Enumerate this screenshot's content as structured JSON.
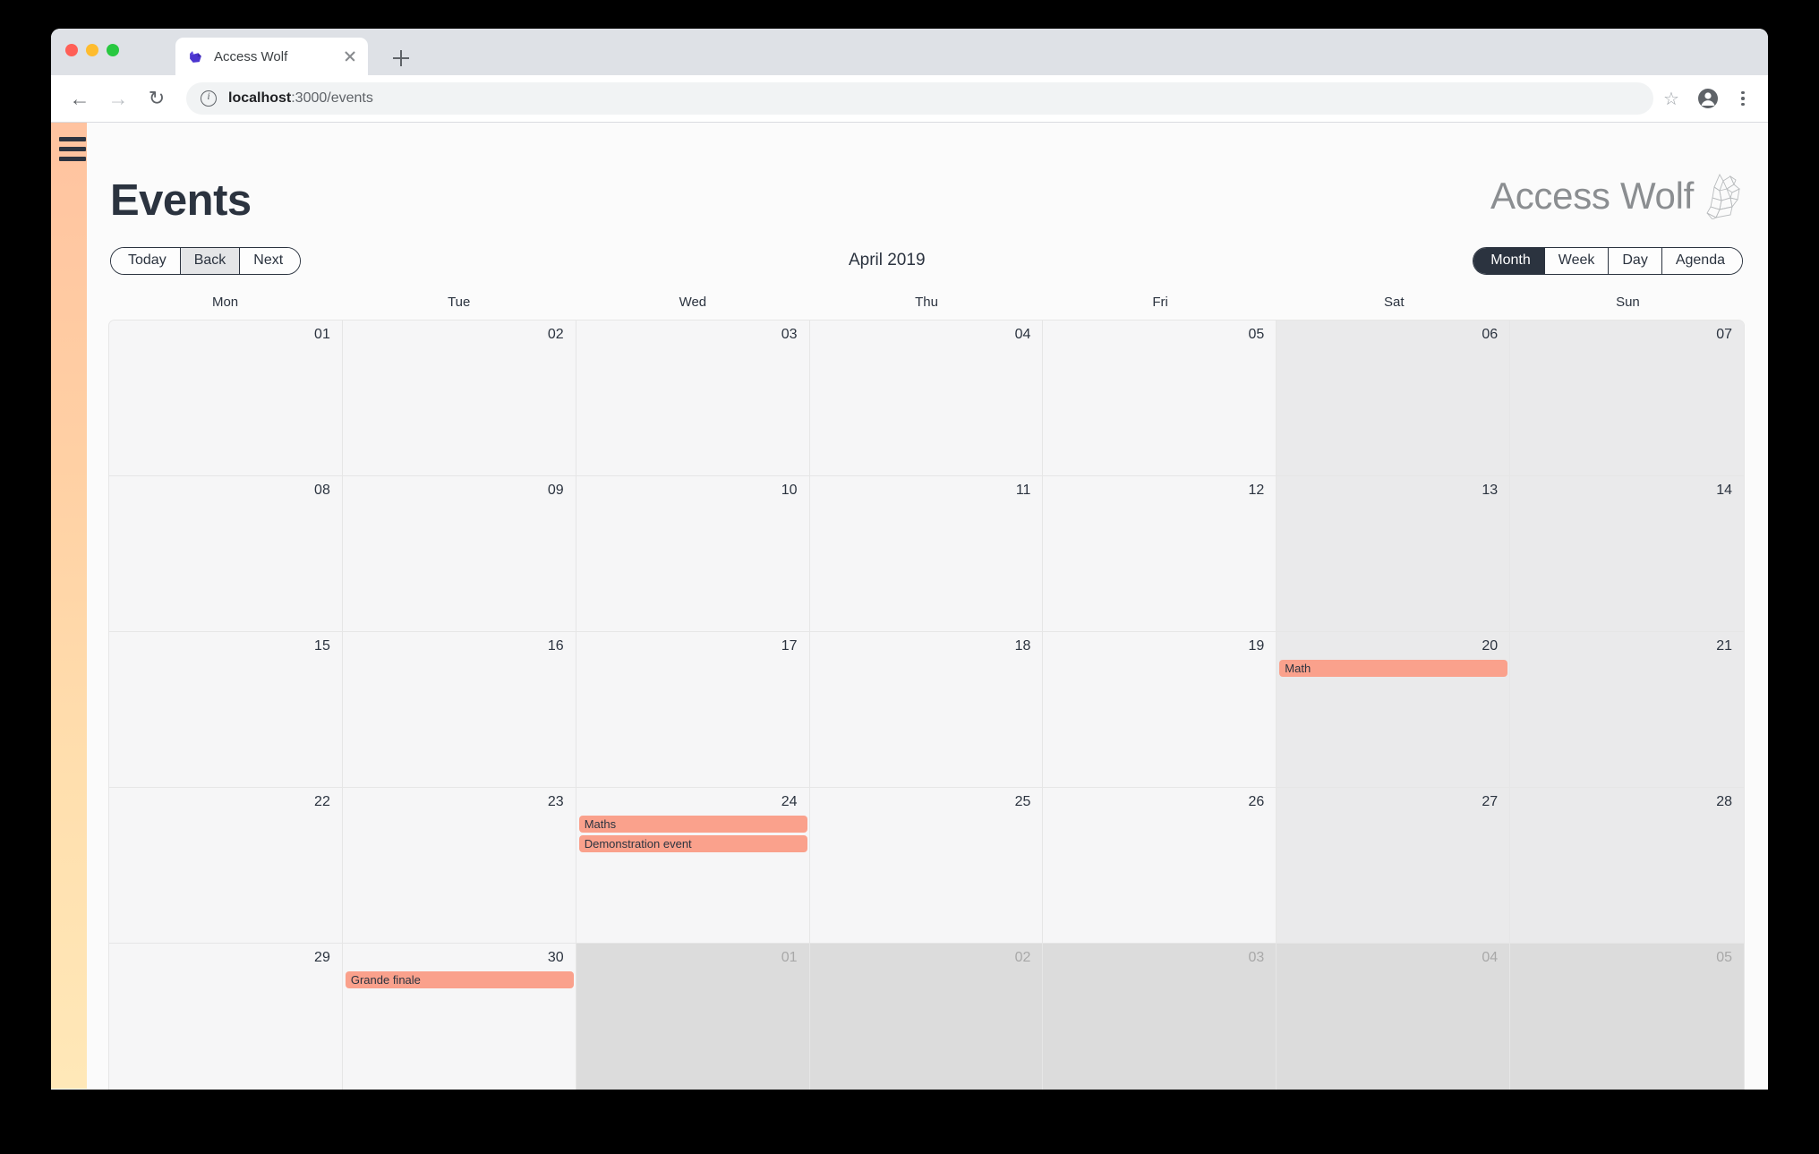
{
  "browser": {
    "tab": {
      "title": "Access Wolf",
      "favicon_icon": "wolf-favicon",
      "close_icon": "close-icon"
    },
    "new_tab_icon": "plus-icon",
    "back_icon": "arrow-left-icon",
    "forward_icon": "arrow-right-icon",
    "reload_icon": "reload-icon",
    "site_info_icon": "info-circle-icon",
    "url_host": "localhost",
    "url_path": ":3000/events",
    "star_icon": "star-icon",
    "profile_icon": "profile-avatar-icon",
    "menu_icon": "three-dot-menu-icon"
  },
  "sidebar": {
    "hamburger_icon": "hamburger-menu-icon",
    "gradient_top": "#ffc3a0",
    "gradient_bottom": "#ffe8b8"
  },
  "header": {
    "title": "Events",
    "brand_name": "Access Wolf",
    "brand_icon": "wolf-head-icon"
  },
  "toolbar": {
    "nav_buttons": [
      {
        "label": "Today",
        "state": "default"
      },
      {
        "label": "Back",
        "state": "hover"
      },
      {
        "label": "Next",
        "state": "default"
      }
    ],
    "current_range_label": "April 2019",
    "view_buttons": [
      {
        "label": "Month",
        "state": "active"
      },
      {
        "label": "Week",
        "state": "default"
      },
      {
        "label": "Day",
        "state": "default"
      },
      {
        "label": "Agenda",
        "state": "default"
      }
    ]
  },
  "calendar": {
    "weekdays": [
      "Mon",
      "Tue",
      "Wed",
      "Thu",
      "Fri",
      "Sat",
      "Sun"
    ],
    "accent_event_color": "#faa18c",
    "weeks": [
      {
        "days": [
          {
            "num": "01",
            "off_month": false,
            "weekend": false,
            "events": []
          },
          {
            "num": "02",
            "off_month": false,
            "weekend": false,
            "events": []
          },
          {
            "num": "03",
            "off_month": false,
            "weekend": false,
            "events": []
          },
          {
            "num": "04",
            "off_month": false,
            "weekend": false,
            "events": []
          },
          {
            "num": "05",
            "off_month": false,
            "weekend": false,
            "events": []
          },
          {
            "num": "06",
            "off_month": false,
            "weekend": true,
            "events": []
          },
          {
            "num": "07",
            "off_month": false,
            "weekend": true,
            "events": []
          }
        ]
      },
      {
        "days": [
          {
            "num": "08",
            "off_month": false,
            "weekend": false,
            "events": []
          },
          {
            "num": "09",
            "off_month": false,
            "weekend": false,
            "events": []
          },
          {
            "num": "10",
            "off_month": false,
            "weekend": false,
            "events": []
          },
          {
            "num": "11",
            "off_month": false,
            "weekend": false,
            "events": []
          },
          {
            "num": "12",
            "off_month": false,
            "weekend": false,
            "events": []
          },
          {
            "num": "13",
            "off_month": false,
            "weekend": true,
            "events": []
          },
          {
            "num": "14",
            "off_month": false,
            "weekend": true,
            "events": []
          }
        ]
      },
      {
        "days": [
          {
            "num": "15",
            "off_month": false,
            "weekend": false,
            "events": []
          },
          {
            "num": "16",
            "off_month": false,
            "weekend": false,
            "events": []
          },
          {
            "num": "17",
            "off_month": false,
            "weekend": false,
            "events": []
          },
          {
            "num": "18",
            "off_month": false,
            "weekend": false,
            "events": []
          },
          {
            "num": "19",
            "off_month": false,
            "weekend": false,
            "events": []
          },
          {
            "num": "20",
            "off_month": false,
            "weekend": true,
            "events": [
              {
                "title": "Math",
                "span": 1
              }
            ]
          },
          {
            "num": "21",
            "off_month": false,
            "weekend": true,
            "events": []
          }
        ]
      },
      {
        "days": [
          {
            "num": "22",
            "off_month": false,
            "weekend": false,
            "events": []
          },
          {
            "num": "23",
            "off_month": false,
            "weekend": false,
            "events": []
          },
          {
            "num": "24",
            "off_month": false,
            "weekend": false,
            "events": [
              {
                "title": "Maths",
                "span": 1
              },
              {
                "title": "Demonstration event",
                "span": 1
              }
            ]
          },
          {
            "num": "25",
            "off_month": false,
            "weekend": false,
            "events": []
          },
          {
            "num": "26",
            "off_month": false,
            "weekend": false,
            "events": []
          },
          {
            "num": "27",
            "off_month": false,
            "weekend": true,
            "events": []
          },
          {
            "num": "28",
            "off_month": false,
            "weekend": true,
            "events": []
          }
        ]
      },
      {
        "days": [
          {
            "num": "29",
            "off_month": false,
            "weekend": false,
            "events": []
          },
          {
            "num": "30",
            "off_month": false,
            "weekend": false,
            "events": [
              {
                "title": "Grande finale",
                "span": 1
              }
            ]
          },
          {
            "num": "01",
            "off_month": true,
            "weekend": false,
            "events": []
          },
          {
            "num": "02",
            "off_month": true,
            "weekend": false,
            "events": []
          },
          {
            "num": "03",
            "off_month": true,
            "weekend": false,
            "events": []
          },
          {
            "num": "04",
            "off_month": true,
            "weekend": true,
            "events": []
          },
          {
            "num": "05",
            "off_month": true,
            "weekend": true,
            "events": []
          }
        ]
      }
    ]
  }
}
